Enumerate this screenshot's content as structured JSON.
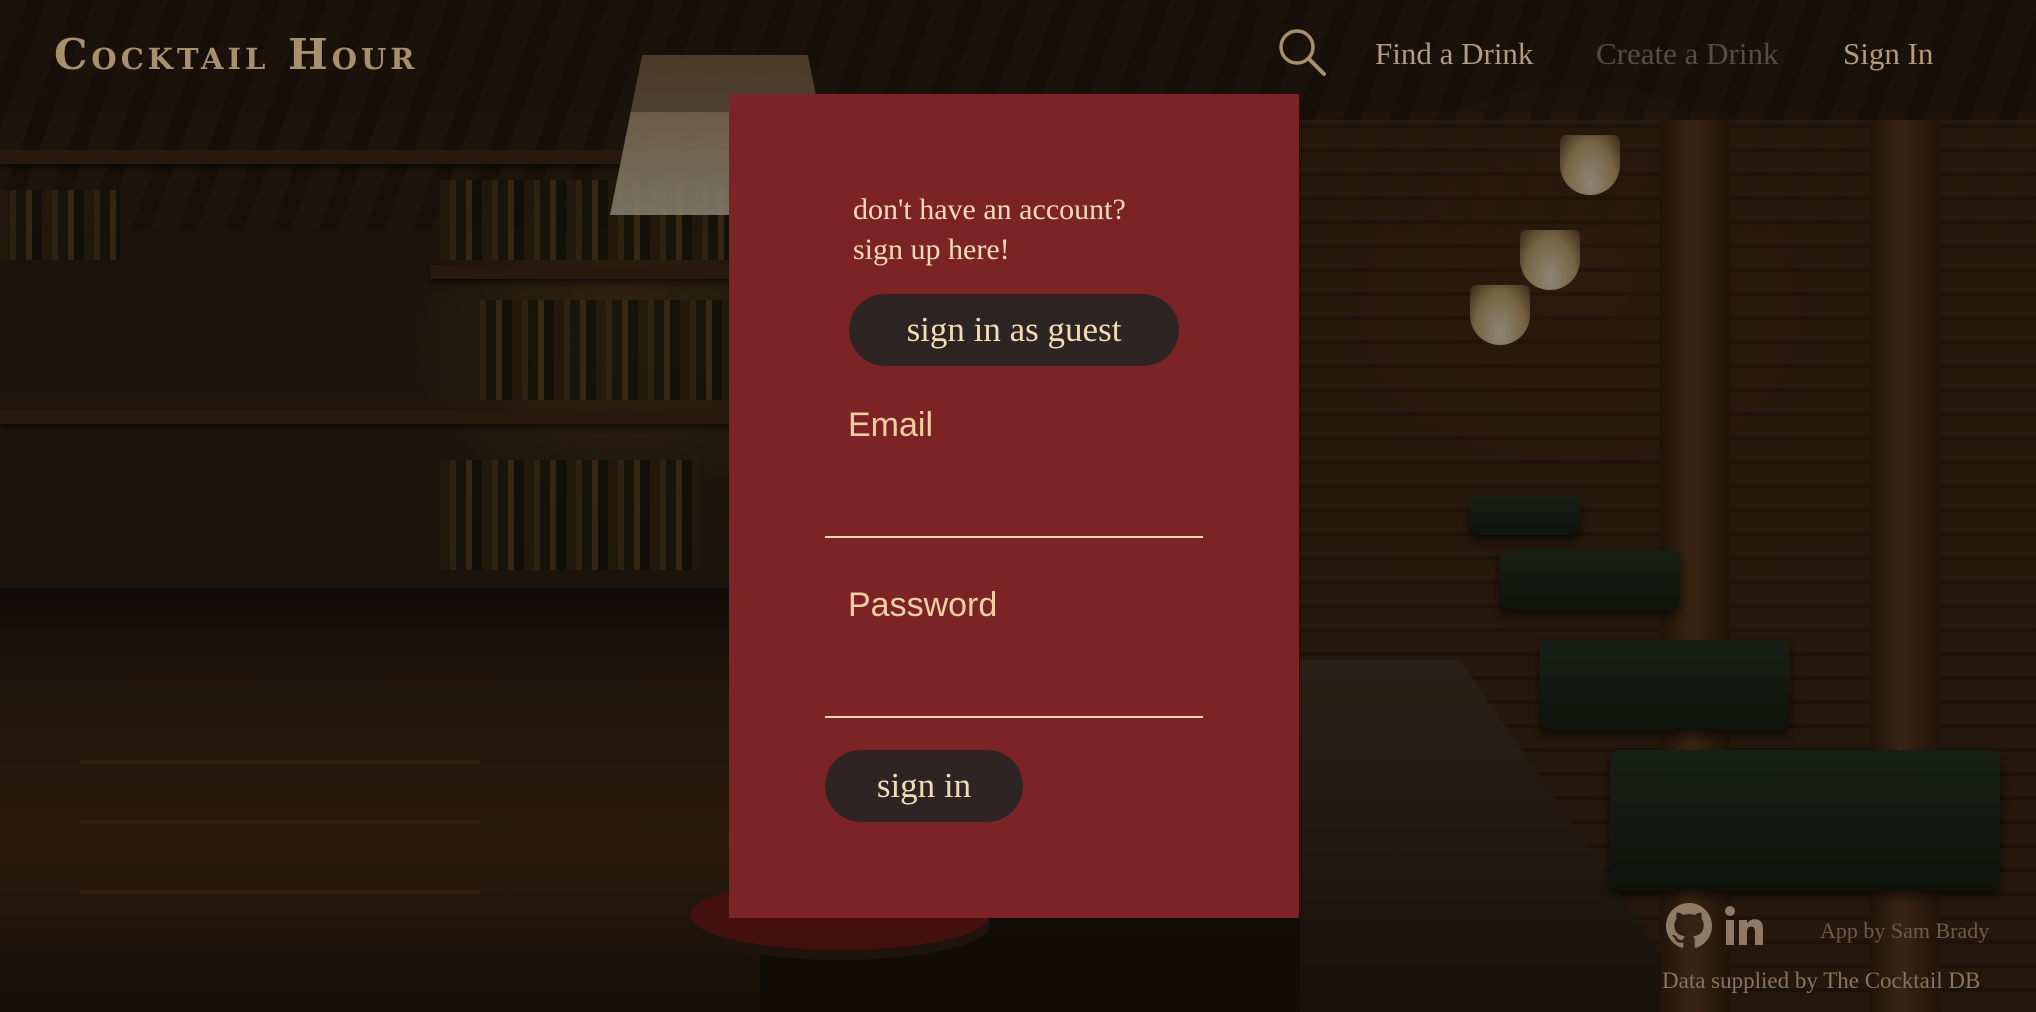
{
  "header": {
    "logo": "Cocktail Hour",
    "search_icon": "search-icon",
    "nav": {
      "find": "Find a Drink",
      "create": "Create a Drink",
      "signin": "Sign In"
    }
  },
  "panel": {
    "signup_line1": "don't have an account?",
    "signup_line2": "sign up here!",
    "guest_button": "sign in as guest",
    "email_label": "Email",
    "email_value": "",
    "password_label": "Password",
    "password_value": "",
    "signin_button": "sign in"
  },
  "footer": {
    "icons": [
      "github-icon",
      "linkedin-icon"
    ],
    "credit": "App by Sam Brady",
    "data_source": "Data supplied by The Cocktail DB"
  },
  "colors": {
    "panel_bg": "#7c2425",
    "button_bg": "#2e2423",
    "button_text": "#f2dcb6",
    "label_text": "#efcfa1",
    "nav_text": "#b39a80",
    "nav_disabled": "#5c4c3f"
  }
}
